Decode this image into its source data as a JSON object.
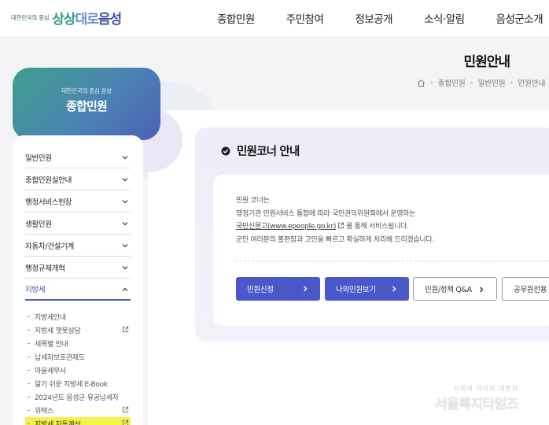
{
  "header": {
    "logo_small": "대한민국의 중심",
    "logo_parts": [
      "상상",
      "대로",
      "음성"
    ],
    "nav": [
      "종합민원",
      "주민참여",
      "정보공개",
      "소식·알림",
      "음성군소개"
    ]
  },
  "page": {
    "title": "민원안내",
    "breadcrumb": [
      "종합민원",
      "일반민원",
      "민원안내"
    ]
  },
  "sidebar": {
    "card_subtitle": "대한민국의 중심 음성",
    "card_title": "종합민원",
    "menu": [
      {
        "label": "일반민원"
      },
      {
        "label": "종합민원실안내"
      },
      {
        "label": "행정서비스헌장"
      },
      {
        "label": "생활민원"
      },
      {
        "label": "자동차/건설기계"
      },
      {
        "label": "행정규제개혁"
      },
      {
        "label": "지방세"
      }
    ],
    "sub_items": [
      {
        "label": "지방세안내",
        "external": false
      },
      {
        "label": "지방세 챗봇상담",
        "external": true
      },
      {
        "label": "세목별 안내",
        "external": false
      },
      {
        "label": "납세자보호관제도",
        "external": false
      },
      {
        "label": "마을세무사",
        "external": false
      },
      {
        "label": "알기 쉬운 지방세 E-Book",
        "external": false
      },
      {
        "label": "2024년도 음성군 유공납세자",
        "external": false
      },
      {
        "label": "위택스",
        "external": true
      },
      {
        "label": "지방세 자동계산",
        "external": true
      }
    ]
  },
  "content": {
    "section_title": "민원코너 안내",
    "line1": "민원 코너는",
    "line2": "행정기관 민원서비스 통합에 따라 국민권익위원회에서 운영하는",
    "link_text": "국민신문고(www.epeople.go.kr)",
    "line3_suffix": "를 통해 서비스됩니다.",
    "line4": "군민 여러분의 불편함과 고민을 빠르고 확실하게 처리해 드리겠습니다.",
    "buttons": [
      "민원신청",
      "나의민원보기",
      "민원/정책 Q&A",
      "공무원전용"
    ]
  },
  "watermark": {
    "small": "사회의 약자의 대변자",
    "big": "서울복지타임즈"
  },
  "colors": {
    "accent": "#4a58c9",
    "highlight": "#f7f24a",
    "active_menu": "#3d4fb0"
  }
}
